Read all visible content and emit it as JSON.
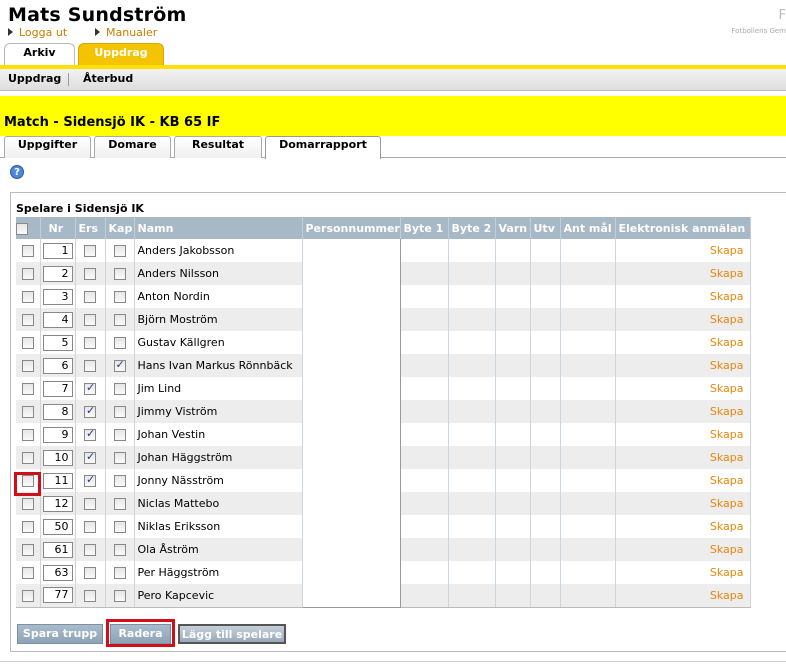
{
  "header": {
    "user_name": "Mats Sundström",
    "links": [
      "Logga ut",
      "Manualer"
    ],
    "org_text": "Fotbollens Gem",
    "corner_char": "F"
  },
  "main_tabs": [
    {
      "label": "Arkiv",
      "active": false
    },
    {
      "label": "Uppdrag",
      "active": true
    }
  ],
  "subnav": [
    "Uppdrag",
    "Återbud"
  ],
  "match_title": "Match - Sidensjö IK - KB 65 IF",
  "tabs": [
    {
      "label": "Uppgifter",
      "active": false
    },
    {
      "label": "Domare",
      "active": false
    },
    {
      "label": "Resultat",
      "active": false
    },
    {
      "label": "Domarrapport",
      "active": true
    }
  ],
  "help_icon_label": "?",
  "section_title": "Spelare i Sidensjö IK",
  "table": {
    "columns": [
      "",
      "Nr",
      "Ers",
      "Kap",
      "Namn",
      "Personnummer",
      "Byte 1",
      "Byte 2",
      "Varn",
      "Utv",
      "Ant mål",
      "Elektronisk anmälan"
    ],
    "action_label": "Skapa",
    "rows": [
      {
        "nr": "1",
        "ers": false,
        "kap": false,
        "name": "Anders Jakobsson"
      },
      {
        "nr": "2",
        "ers": false,
        "kap": false,
        "name": "Anders Nilsson"
      },
      {
        "nr": "3",
        "ers": false,
        "kap": false,
        "name": "Anton Nordin"
      },
      {
        "nr": "4",
        "ers": false,
        "kap": false,
        "name": "Björn Moström"
      },
      {
        "nr": "5",
        "ers": false,
        "kap": false,
        "name": "Gustav Källgren"
      },
      {
        "nr": "6",
        "ers": false,
        "kap": true,
        "name": "Hans Ivan Markus Rönnbäck"
      },
      {
        "nr": "7",
        "ers": true,
        "kap": false,
        "name": "Jim Lind"
      },
      {
        "nr": "8",
        "ers": true,
        "kap": false,
        "name": "Jimmy Viström"
      },
      {
        "nr": "9",
        "ers": true,
        "kap": false,
        "name": "Johan Vestin"
      },
      {
        "nr": "10",
        "ers": true,
        "kap": false,
        "name": "Johan Häggström"
      },
      {
        "nr": "11",
        "ers": true,
        "kap": false,
        "name": "Jonny Näsström"
      },
      {
        "nr": "12",
        "ers": false,
        "kap": false,
        "name": "Niclas Mattebo"
      },
      {
        "nr": "50",
        "ers": false,
        "kap": false,
        "name": "Niklas Eriksson"
      },
      {
        "nr": "61",
        "ers": false,
        "kap": false,
        "name": "Ola Åström"
      },
      {
        "nr": "63",
        "ers": false,
        "kap": false,
        "name": "Per Häggström"
      },
      {
        "nr": "77",
        "ers": false,
        "kap": false,
        "name": "Pero Kapcevic"
      }
    ]
  },
  "buttons": {
    "save": "Spara trupp",
    "delete": "Radera",
    "add": "Lägg till spelare"
  },
  "colors": {
    "brand_yellow": "#ffff00",
    "tab_active": "#f4c400",
    "table_header": "#a7b8c6",
    "action_link": "#e8860c",
    "highlight": "#d40d1b"
  }
}
